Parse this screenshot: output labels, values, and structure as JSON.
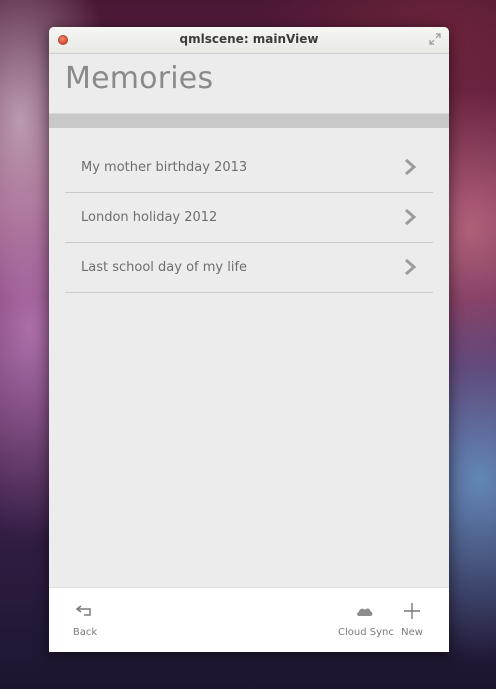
{
  "window": {
    "title": "qmlscene: mainView"
  },
  "page": {
    "title": "Memories"
  },
  "memories": [
    {
      "label": "My mother birthday 2013"
    },
    {
      "label": "London holiday 2012"
    },
    {
      "label": "Last school day of my life"
    }
  ],
  "toolbar": {
    "back_label": "Back",
    "cloud_sync_label": "Cloud Sync",
    "new_label": "New"
  },
  "icons": {
    "close": "close-icon",
    "maximize": "maximize-icon",
    "chevron": "chevron-right-icon",
    "back": "back-arrow-icon",
    "cloud": "cloud-icon",
    "new": "plus-icon"
  },
  "colors": {
    "close_button": "#e0533a",
    "window_background": "#ececec",
    "divider": "#c8c8c8",
    "title_text": "#8a8a8a",
    "item_text": "#6e6e6e"
  }
}
